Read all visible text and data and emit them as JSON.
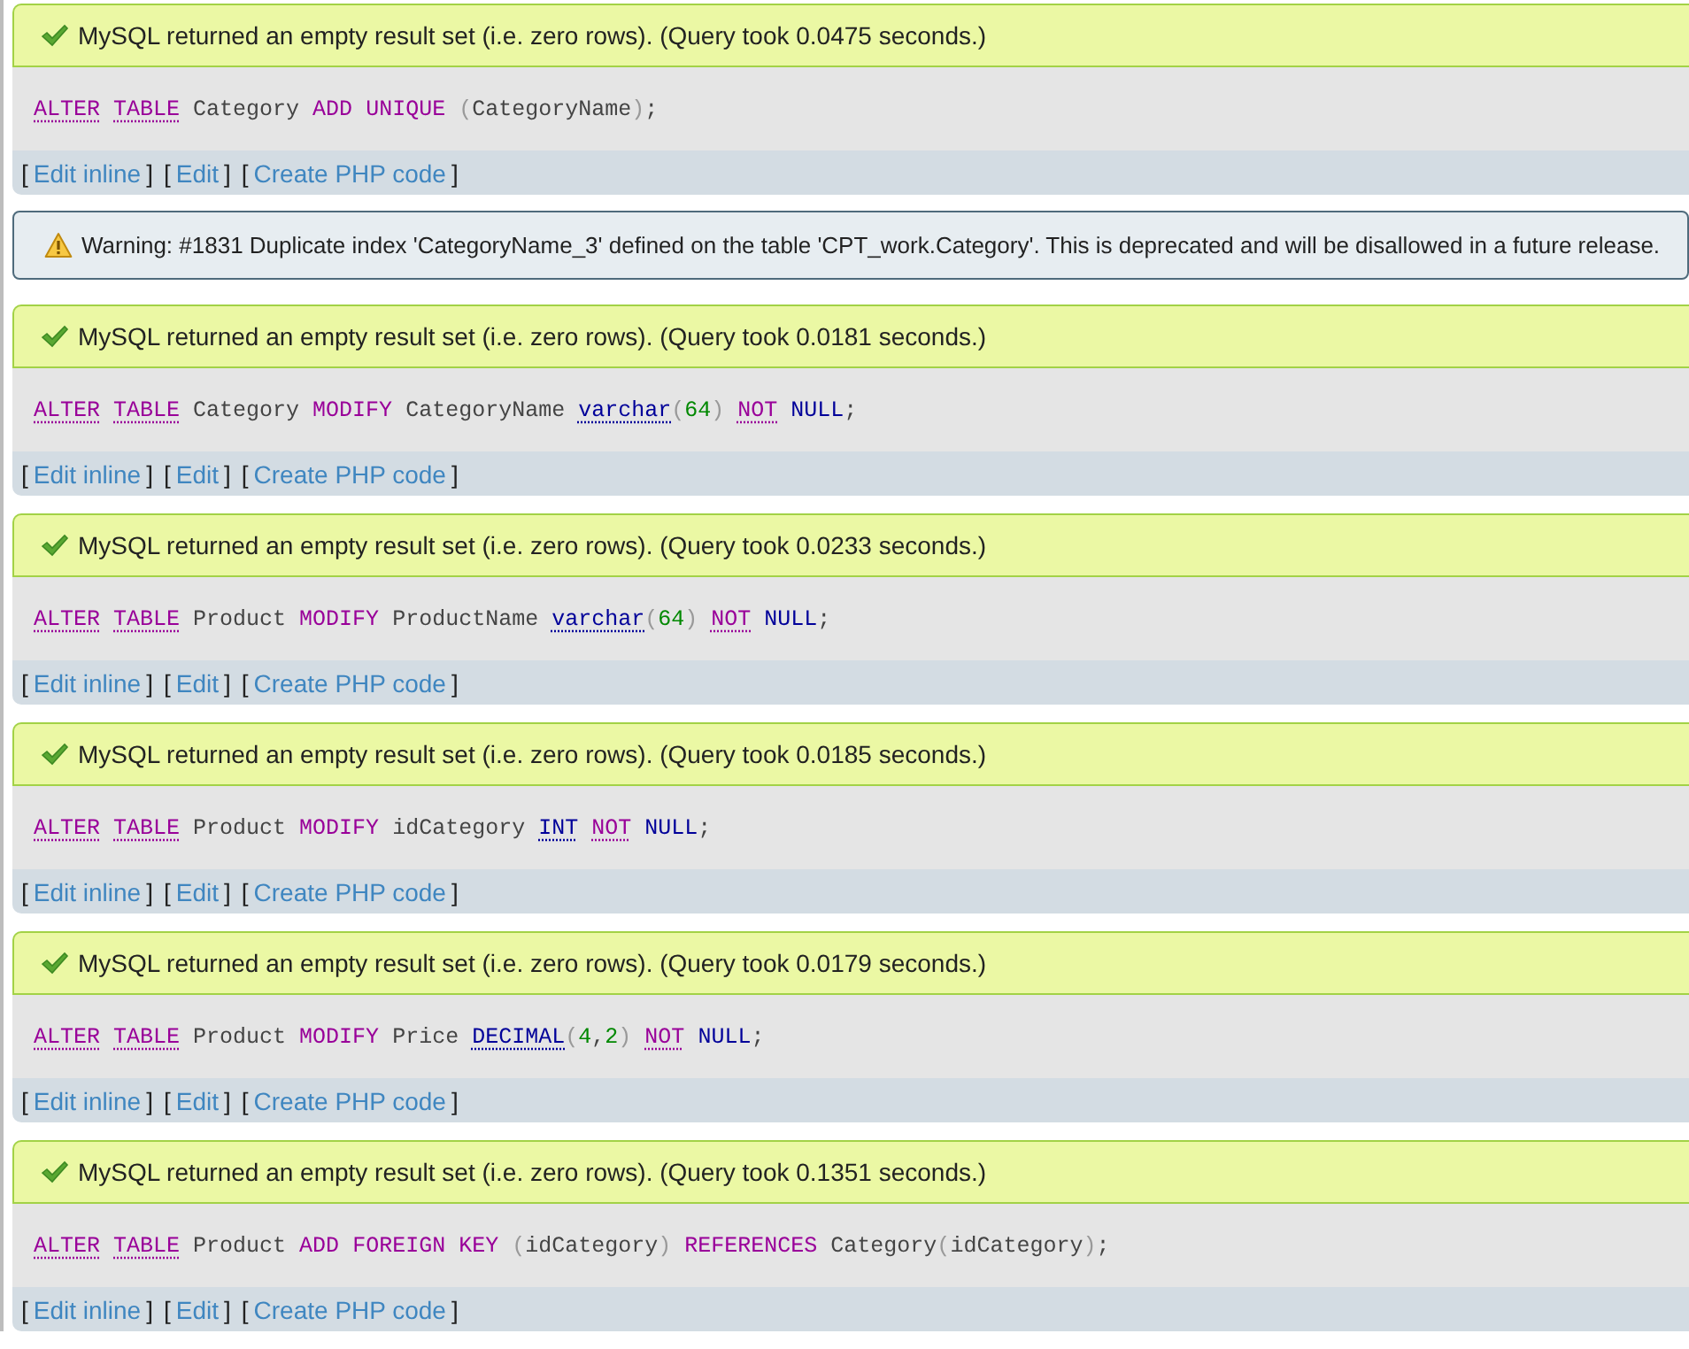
{
  "messages": [
    {
      "kind": "success",
      "message": "MySQL returned an empty result set (i.e. zero rows). (Query took 0.0475 seconds.)",
      "sql": [
        {
          "text": "ALTER",
          "kind": "doc-keyword"
        },
        {
          "text": "TABLE",
          "kind": "doc-keyword"
        },
        {
          "text": "Category",
          "kind": "ident"
        },
        {
          "text": "ADD",
          "kind": "keyword"
        },
        {
          "text": "UNIQUE",
          "kind": "keyword"
        },
        {
          "text": "(",
          "kind": "open-paren"
        },
        {
          "text": "CategoryName",
          "kind": "ident"
        },
        {
          "text": ")",
          "kind": "close-paren"
        },
        {
          "text": ";",
          "kind": "punct"
        }
      ],
      "actions": [
        {
          "open": "[",
          "label": "Edit inline",
          "close": "]"
        },
        {
          "open": "[",
          "label": "Edit",
          "close": "]"
        },
        {
          "open": "[",
          "label": "Create PHP code",
          "close": "]"
        }
      ]
    },
    {
      "kind": "warning",
      "message": "Warning: #1831 Duplicate index 'CategoryName_3' defined on the table 'CPT_work.Category'. This is deprecated and will be disallowed in a future release."
    },
    {
      "kind": "success",
      "message": "MySQL returned an empty result set (i.e. zero rows). (Query took 0.0181 seconds.)",
      "sql": [
        {
          "text": "ALTER",
          "kind": "doc-keyword"
        },
        {
          "text": "TABLE",
          "kind": "doc-keyword"
        },
        {
          "text": "Category",
          "kind": "ident"
        },
        {
          "text": "MODIFY",
          "kind": "keyword"
        },
        {
          "text": "CategoryName",
          "kind": "ident"
        },
        {
          "text": "varchar",
          "kind": "type"
        },
        {
          "text": "(",
          "kind": "open-paren"
        },
        {
          "text": "64",
          "kind": "number"
        },
        {
          "text": ")",
          "kind": "close-paren"
        },
        {
          "text": "NOT",
          "kind": "doc-keyword"
        },
        {
          "text": "NULL",
          "kind": "null"
        },
        {
          "text": ";",
          "kind": "punct"
        }
      ],
      "actions": [
        {
          "open": "[",
          "label": "Edit inline",
          "close": "]"
        },
        {
          "open": "[",
          "label": "Edit",
          "close": "]"
        },
        {
          "open": "[",
          "label": "Create PHP code",
          "close": "]"
        }
      ]
    },
    {
      "kind": "success",
      "message": "MySQL returned an empty result set (i.e. zero rows). (Query took 0.0233 seconds.)",
      "sql": [
        {
          "text": "ALTER",
          "kind": "doc-keyword"
        },
        {
          "text": "TABLE",
          "kind": "doc-keyword"
        },
        {
          "text": "Product",
          "kind": "ident"
        },
        {
          "text": "MODIFY",
          "kind": "keyword"
        },
        {
          "text": "ProductName",
          "kind": "ident"
        },
        {
          "text": "varchar",
          "kind": "type"
        },
        {
          "text": "(",
          "kind": "open-paren"
        },
        {
          "text": "64",
          "kind": "number"
        },
        {
          "text": ")",
          "kind": "close-paren"
        },
        {
          "text": "NOT",
          "kind": "doc-keyword"
        },
        {
          "text": "NULL",
          "kind": "null"
        },
        {
          "text": ";",
          "kind": "punct"
        }
      ],
      "actions": [
        {
          "open": "[",
          "label": "Edit inline",
          "close": "]"
        },
        {
          "open": "[",
          "label": "Edit",
          "close": "]"
        },
        {
          "open": "[",
          "label": "Create PHP code",
          "close": "]"
        }
      ]
    },
    {
      "kind": "success",
      "message": "MySQL returned an empty result set (i.e. zero rows). (Query took 0.0185 seconds.)",
      "sql": [
        {
          "text": "ALTER",
          "kind": "doc-keyword"
        },
        {
          "text": "TABLE",
          "kind": "doc-keyword"
        },
        {
          "text": "Product",
          "kind": "ident"
        },
        {
          "text": "MODIFY",
          "kind": "keyword"
        },
        {
          "text": "idCategory",
          "kind": "ident"
        },
        {
          "text": "INT",
          "kind": "type"
        },
        {
          "text": "NOT",
          "kind": "doc-keyword"
        },
        {
          "text": "NULL",
          "kind": "null"
        },
        {
          "text": ";",
          "kind": "punct"
        }
      ],
      "actions": [
        {
          "open": "[",
          "label": "Edit inline",
          "close": "]"
        },
        {
          "open": "[",
          "label": "Edit",
          "close": "]"
        },
        {
          "open": "[",
          "label": "Create PHP code",
          "close": "]"
        }
      ]
    },
    {
      "kind": "success",
      "message": "MySQL returned an empty result set (i.e. zero rows). (Query took 0.0179 seconds.)",
      "sql": [
        {
          "text": "ALTER",
          "kind": "doc-keyword"
        },
        {
          "text": "TABLE",
          "kind": "doc-keyword"
        },
        {
          "text": "Product",
          "kind": "ident"
        },
        {
          "text": "MODIFY",
          "kind": "keyword"
        },
        {
          "text": "Price",
          "kind": "ident"
        },
        {
          "text": "DECIMAL",
          "kind": "type"
        },
        {
          "text": "(",
          "kind": "open-paren"
        },
        {
          "text": "4",
          "kind": "number"
        },
        {
          "text": ",",
          "kind": "punct"
        },
        {
          "text": "2",
          "kind": "number"
        },
        {
          "text": ")",
          "kind": "close-paren"
        },
        {
          "text": "NOT",
          "kind": "doc-keyword"
        },
        {
          "text": "NULL",
          "kind": "null"
        },
        {
          "text": ";",
          "kind": "punct"
        }
      ],
      "actions": [
        {
          "open": "[",
          "label": "Edit inline",
          "close": "]"
        },
        {
          "open": "[",
          "label": "Edit",
          "close": "]"
        },
        {
          "open": "[",
          "label": "Create PHP code",
          "close": "]"
        }
      ]
    },
    {
      "kind": "success",
      "message": "MySQL returned an empty result set (i.e. zero rows). (Query took 0.1351 seconds.)",
      "sql": [
        {
          "text": "ALTER",
          "kind": "doc-keyword"
        },
        {
          "text": "TABLE",
          "kind": "doc-keyword"
        },
        {
          "text": "Product",
          "kind": "ident"
        },
        {
          "text": "ADD",
          "kind": "keyword"
        },
        {
          "text": "FOREIGN",
          "kind": "keyword"
        },
        {
          "text": "KEY",
          "kind": "keyword"
        },
        {
          "text": "(",
          "kind": "open-paren"
        },
        {
          "text": "idCategory",
          "kind": "ident"
        },
        {
          "text": ")",
          "kind": "close-paren"
        },
        {
          "text": "REFERENCES",
          "kind": "keyword"
        },
        {
          "text": "Category",
          "kind": "ident"
        },
        {
          "text": "(",
          "kind": "open-paren"
        },
        {
          "text": "idCategory",
          "kind": "ident"
        },
        {
          "text": ")",
          "kind": "close-paren"
        },
        {
          "text": ";",
          "kind": "punct"
        }
      ],
      "actions": [
        {
          "open": "[",
          "label": "Edit inline",
          "close": "]"
        },
        {
          "open": "[",
          "label": "Edit",
          "close": "]"
        },
        {
          "open": "[",
          "label": "Create PHP code",
          "close": "]"
        }
      ]
    }
  ]
}
